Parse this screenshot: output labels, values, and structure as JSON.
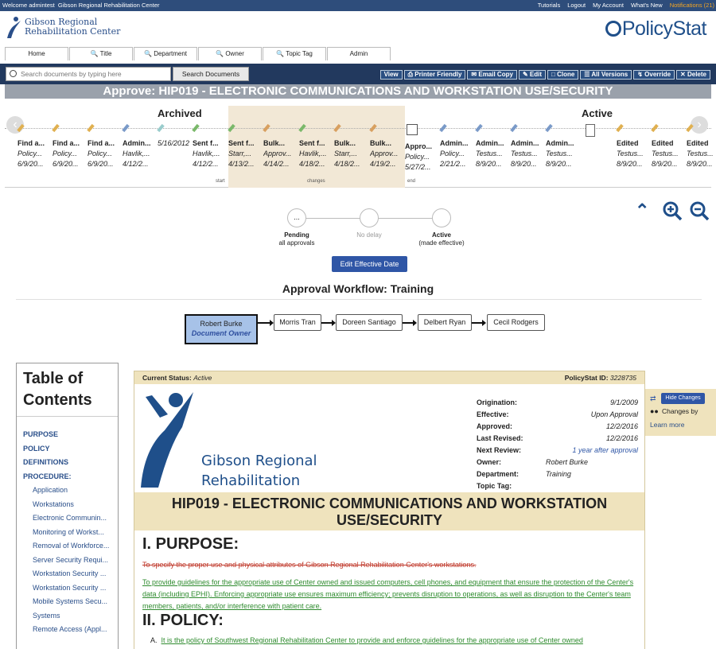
{
  "topbar": {
    "welcome": "Welcome admintest",
    "org": "Gibson Regional Rehabilitation Center",
    "links": [
      "Tutorials",
      "Logout",
      "My Account",
      "What's New"
    ],
    "notifications": "Notifications (21)"
  },
  "header": {
    "org_line1": "Gibson Regional",
    "org_line2": "Rehabilitation Center",
    "brand": "PolicyStat"
  },
  "nav_tabs": [
    "Home",
    "Title",
    "Department",
    "Owner",
    "Topic Tag",
    "Admin"
  ],
  "search": {
    "placeholder": "Search documents by typing here",
    "button": "Search Documents"
  },
  "actions": [
    "View",
    "Printer Friendly",
    "Email Copy",
    "Edit",
    "Clone",
    "All Versions",
    "Override",
    "Delete"
  ],
  "page_title": "Approve: HIP019 - ELECTRONIC COMMUNICATIONS AND WORKSTATION USE/SECURITY",
  "timeline": {
    "archived_label": "Archived",
    "active_label": "Active",
    "start_label": "start",
    "changes_label": "changes",
    "end_label": "end",
    "items": [
      {
        "t1": "Find a...",
        "t2": "Policy...",
        "t3": "6/9/20..."
      },
      {
        "t1": "Find a...",
        "t2": "Policy...",
        "t3": "6/9/20..."
      },
      {
        "t1": "Find a...",
        "t2": "Policy...",
        "t3": "6/9/20..."
      },
      {
        "t1": "Admin...",
        "t2": "Havlik,...",
        "t3": "4/12/2..."
      },
      {
        "t1": "5/16/2012",
        "t2": "",
        "t3": ""
      },
      {
        "t1": "Sent f...",
        "t2": "Havlik,...",
        "t3": "4/12/2..."
      },
      {
        "t1": "Sent f...",
        "t2": "Starr,...",
        "t3": "4/13/2..."
      },
      {
        "t1": "Bulk...",
        "t2": "Approv...",
        "t3": "4/14/2..."
      },
      {
        "t1": "Sent f...",
        "t2": "Havlik,...",
        "t3": "4/18/2..."
      },
      {
        "t1": "Bulk...",
        "t2": "Starr,...",
        "t3": "4/18/2..."
      },
      {
        "t1": "Bulk...",
        "t2": "Approv...",
        "t3": "4/19/2..."
      },
      {
        "t1": "Appro...",
        "t2": "Policy...",
        "t3": "5/27/2..."
      },
      {
        "t1": "Admin...",
        "t2": "Policy...",
        "t3": "2/21/2..."
      },
      {
        "t1": "Admin...",
        "t2": "Testus...",
        "t3": "8/9/20..."
      },
      {
        "t1": "Admin...",
        "t2": "Testus...",
        "t3": "8/9/20..."
      },
      {
        "t1": "Admin...",
        "t2": "Testus...",
        "t3": "8/9/20..."
      },
      {
        "t1": "",
        "t2": "",
        "t3": ""
      },
      {
        "t1": "Edited",
        "t2": "Testus...",
        "t3": "8/9/20..."
      },
      {
        "t1": "Edited",
        "t2": "Testus...",
        "t3": "8/9/20..."
      },
      {
        "t1": "Edited",
        "t2": "Testus...",
        "t3": "8/9/20..."
      }
    ]
  },
  "steps": {
    "pending_symbol": "...",
    "pending_title": "Pending",
    "pending_sub": "all approvals",
    "delay": "No delay",
    "active_title": "Active",
    "active_sub": "(made effective)",
    "button": "Edit Effective Date"
  },
  "workflow": {
    "title": "Approval Workflow: Training",
    "owner_name": "Robert Burke",
    "owner_role": "Document Owner",
    "approvers": [
      "Morris Tran",
      "Doreen Santiago",
      "Delbert Ryan",
      "Cecil Rodgers"
    ]
  },
  "toc": {
    "title": "Table of Contents",
    "items": [
      {
        "label": "PURPOSE",
        "level": "top"
      },
      {
        "label": "POLICY",
        "level": "top"
      },
      {
        "label": "DEFINITIONS",
        "level": "top"
      },
      {
        "label": "PROCEDURE:",
        "level": "top"
      },
      {
        "label": "Application",
        "level": "sub"
      },
      {
        "label": "Workstations",
        "level": "sub"
      },
      {
        "label": "Electronic Communin...",
        "level": "sub"
      },
      {
        "label": "Monitoring of Workst...",
        "level": "sub"
      },
      {
        "label": "Removal of Workforce...",
        "level": "sub"
      },
      {
        "label": "Server Security Requi...",
        "level": "sub"
      },
      {
        "label": "Workstation Security ...",
        "level": "sub"
      },
      {
        "label": "Workstation Security ...",
        "level": "sub"
      },
      {
        "label": "Mobile Systems Secu...",
        "level": "sub"
      },
      {
        "label": "Systems",
        "level": "sub"
      },
      {
        "label": "Remote Access (Appl...",
        "level": "sub"
      }
    ]
  },
  "document": {
    "status_label": "Current Status:",
    "status_value": "Active",
    "id_label": "PolicyStat ID:",
    "id_value": "3228735",
    "logo_line1": "Gibson Regional",
    "logo_line2": "Rehabilitation Center",
    "meta": [
      {
        "k": "Origination:",
        "v": "9/1/2009"
      },
      {
        "k": "Effective:",
        "v": "Upon Approval"
      },
      {
        "k": "Approved:",
        "v": "12/2/2016"
      },
      {
        "k": "Last Revised:",
        "v": "12/2/2016"
      },
      {
        "k": "Next Review:",
        "v": "1 year after approval"
      },
      {
        "k": "Owner:",
        "v": "Robert Burke"
      },
      {
        "k": "Department:",
        "v": "Training"
      },
      {
        "k": "Topic Tag:",
        "v": ""
      }
    ],
    "title_line1": "HIP019 - ELECTRONIC COMMUNICATIONS AND WORKSTATION",
    "title_line2": "USE/SECURITY",
    "purpose_heading": "I. PURPOSE:",
    "purpose_deleted": "To specify the proper use and physical attributes of Gibson Regional Rehabilitation Center's workstations.",
    "purpose_inserted": "To provide guidelines for the appropriate use of Center owned and issued computers, cell phones, and equipment that ensure the protection of the Center's data (including EPHI). Enforcing appropriate use ensures maximum efficiency; prevents disruption to operations, as well as disruption to the Center's team members, patients, and/or interference with patient care.",
    "policy_heading": "II. POLICY:",
    "policy_a_marker": "A.",
    "policy_a": "It is the policy of Southwest Regional Rehabilitation Center to provide and enforce guidelines for the appropriate use of Center owned"
  },
  "side_panel": {
    "hide_button": "Hide Changes",
    "changes_by": "Changes by",
    "learn_more": "Learn more"
  },
  "colors": {
    "navy": "#22395e",
    "button_blue": "#2f56a6",
    "tan": "#efe3bd",
    "deleted_red": "#c0392b",
    "inserted_green": "#2e8b2e"
  }
}
